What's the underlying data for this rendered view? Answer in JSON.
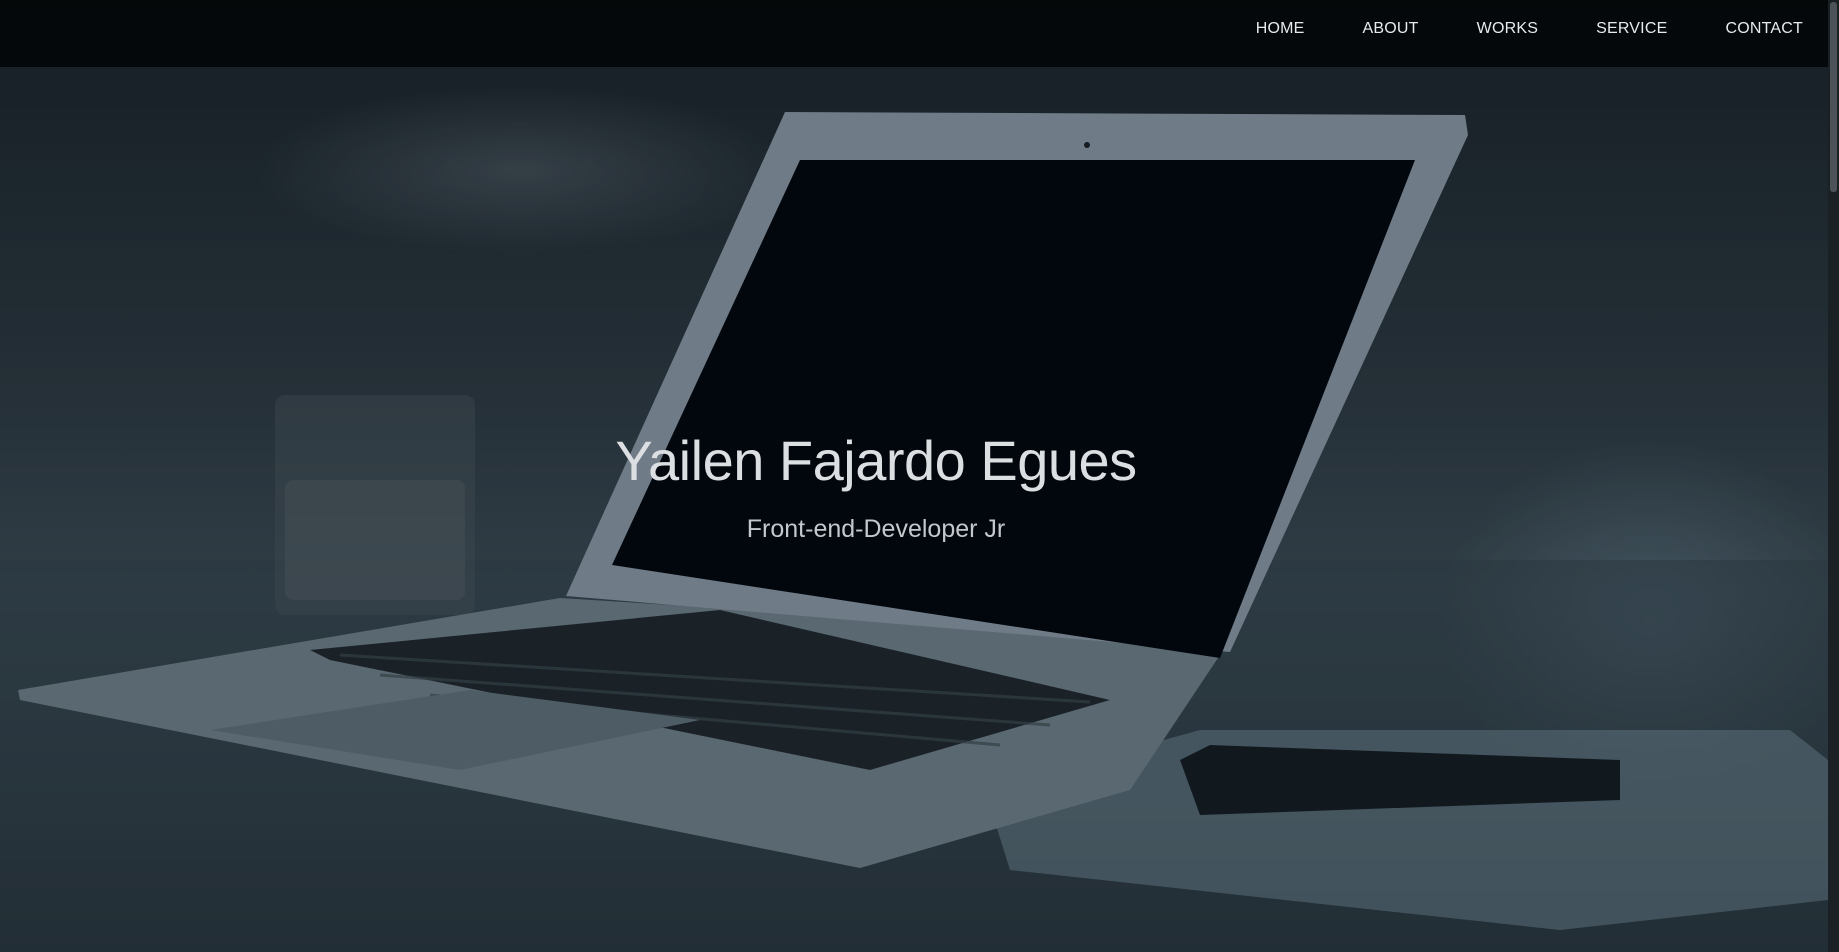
{
  "nav": {
    "items": [
      {
        "label": "HOME"
      },
      {
        "label": "ABOUT"
      },
      {
        "label": "WORKS"
      },
      {
        "label": "SERVICE"
      },
      {
        "label": "CONTACT"
      }
    ]
  },
  "hero": {
    "title": "Yailen Fajardo Egues",
    "subtitle": "Front-end-Developer Jr",
    "background_image": "laptop-on-desk-photo"
  },
  "colors": {
    "navbar_bg": "#040608",
    "nav_text": "#e8eaec",
    "title_text": "#dcdfe2",
    "subtitle_text": "#c4c8cc",
    "overlay_tint": "#081018"
  }
}
